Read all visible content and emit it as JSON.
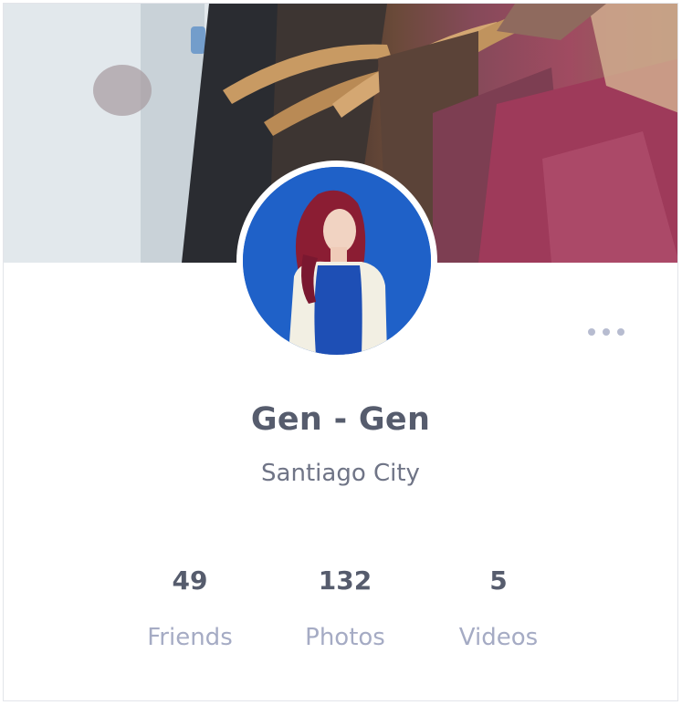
{
  "profile": {
    "name": "Gen - Gen",
    "location": "Santiago City"
  },
  "menu": {
    "icon": "more-horizontal-icon"
  },
  "stats": [
    {
      "value": "49",
      "label": "Friends"
    },
    {
      "value": "132",
      "label": "Photos"
    },
    {
      "value": "5",
      "label": "Videos"
    }
  ],
  "colors": {
    "avatar_background": "#1f61c8",
    "name_text": "#565c6d",
    "label_text": "#a5abc4",
    "menu_dots": "#b7bcd0"
  }
}
